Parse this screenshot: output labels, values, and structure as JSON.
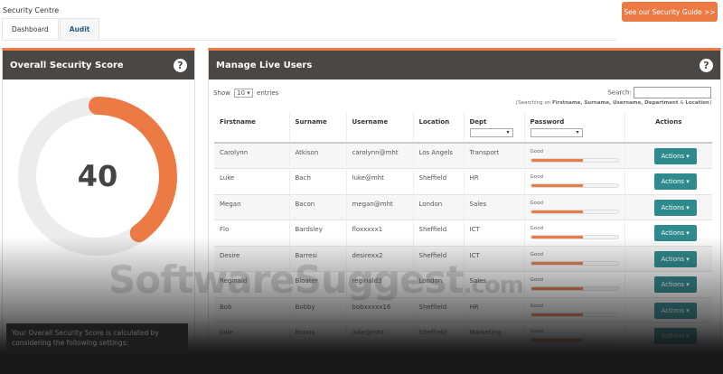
{
  "app": {
    "title": "Security Centre",
    "guide_button": "See our Security Guide >>"
  },
  "tabs": [
    {
      "label": "Dashboard"
    },
    {
      "label": "Audit"
    }
  ],
  "score_panel": {
    "title": "Overall Security Score",
    "score": "40",
    "score_value": 40,
    "score_max": 100,
    "tooltip": "Your Overall Security Score is calculated by considering the following settings:"
  },
  "users_panel": {
    "title": "Manage Live Users",
    "show_label": "Show",
    "entries_value": "10",
    "entries_label": "entries",
    "search_label": "Search:",
    "search_value": "",
    "search_hint_prefix": "[Searching on ",
    "search_hint_fields": "Firstname, Surname, Username, Department",
    "search_hint_amp": " & ",
    "search_hint_last": "Location",
    "search_hint_suffix": "]",
    "columns": [
      "Firstname",
      "Surname",
      "Username",
      "Location",
      "Dept",
      "Password",
      "Actions"
    ],
    "rows": [
      {
        "first": "Carolynn",
        "last": "Atkison",
        "user": "carolynn@mht",
        "loc": "Los Angels",
        "dept": "Transport",
        "pw": "Good",
        "strength": 60,
        "action": "Actions"
      },
      {
        "first": "Luke",
        "last": "Bach",
        "user": "luke@mht",
        "loc": "Sheffield",
        "dept": "HR",
        "pw": "Good",
        "strength": 60,
        "action": "Actions"
      },
      {
        "first": "Megan",
        "last": "Bacon",
        "user": "megan@mht",
        "loc": "London",
        "dept": "Sales",
        "pw": "Good",
        "strength": 60,
        "action": "Actions"
      },
      {
        "first": "Flo",
        "last": "Bardsley",
        "user": "floxxxxx1",
        "loc": "Sheffield",
        "dept": "ICT",
        "pw": "Good",
        "strength": 60,
        "action": "Actions"
      },
      {
        "first": "Desire",
        "last": "Barresi",
        "user": "desirexx2",
        "loc": "Sheffield",
        "dept": "ICT",
        "pw": "Good",
        "strength": 60,
        "action": "Actions"
      },
      {
        "first": "Reginald",
        "last": "Bloater",
        "user": "reginald3",
        "loc": "London",
        "dept": "Sales",
        "pw": "Good",
        "strength": 60,
        "action": "Actions"
      },
      {
        "first": "Bob",
        "last": "Bobby",
        "user": "bobxxxxx16",
        "loc": "Sheffield",
        "dept": "HR",
        "pw": "Good",
        "strength": 60,
        "action": "Actions"
      },
      {
        "first": "Julie",
        "last": "Bonus",
        "user": "julie@mht",
        "loc": "Sheffield",
        "dept": "Marketing",
        "pw": "Good",
        "strength": 60,
        "action": "Actions"
      }
    ]
  },
  "watermark": {
    "main": "SoftwareSuggest",
    "suffix": ".com"
  },
  "colors": {
    "accent": "#ec7a44",
    "action": "#2e8a8c",
    "header": "#4a4745"
  }
}
